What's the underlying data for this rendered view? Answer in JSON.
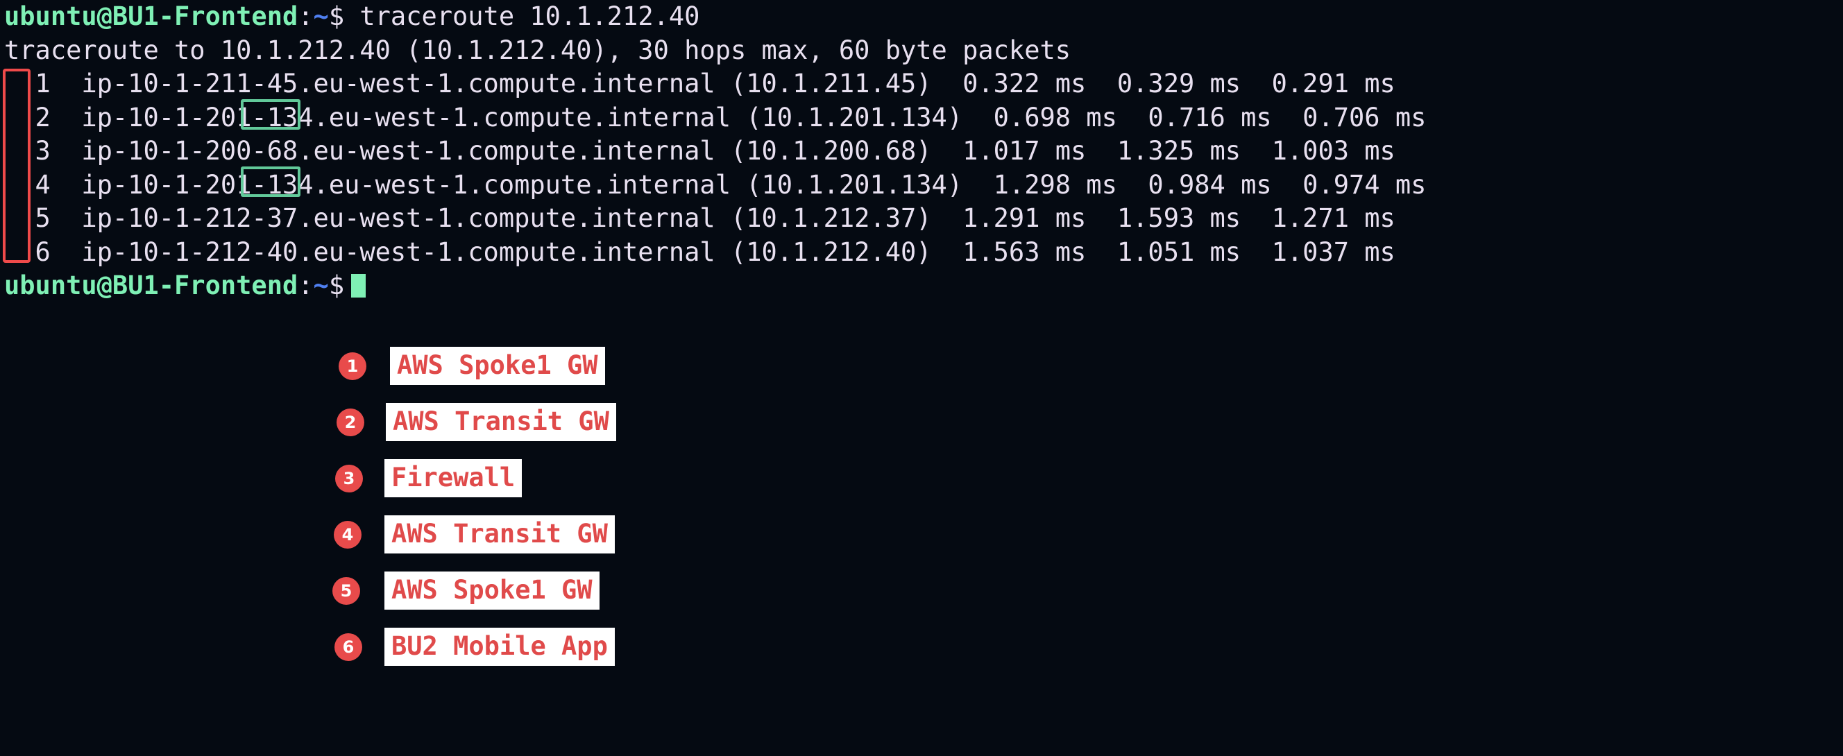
{
  "terminal": {
    "background_color": "#050a12",
    "text_color": "#e8e0f0",
    "prompt_color": "#7ff0b5",
    "prompt": {
      "user_host": "ubuntu@BU1-Frontend",
      "colon": ":",
      "path": "~",
      "dollar": "$"
    },
    "command": " traceroute 10.1.212.40",
    "header_line": "traceroute to 10.1.212.40 (10.1.212.40), 30 hops max, 60 byte packets",
    "hops": [
      {
        "num": "1",
        "hostname": "ip-10-1-211-45.eu-west-1.compute.internal",
        "ip": "(10.1.211.45)",
        "rtt1": "0.322 ms",
        "rtt2": "0.329 ms",
        "rtt3": "0.291 ms",
        "line": "  1  ip-10-1-211-45.eu-west-1.compute.internal (10.1.211.45)  0.322 ms  0.329 ms  0.291 ms"
      },
      {
        "num": "2",
        "hostname": "ip-10-1-201-134.eu-west-1.compute.internal",
        "ip": "(10.1.201.134)",
        "rtt1": "0.698 ms",
        "rtt2": "0.716 ms",
        "rtt3": "0.706 ms",
        "line": "  2  ip-10-1-201-134.eu-west-1.compute.internal (10.1.201.134)  0.698 ms  0.716 ms  0.706 ms"
      },
      {
        "num": "3",
        "hostname": "ip-10-1-200-68.eu-west-1.compute.internal",
        "ip": "(10.1.200.68)",
        "rtt1": "1.017 ms",
        "rtt2": "1.325 ms",
        "rtt3": "1.003 ms",
        "line": "  3  ip-10-1-200-68.eu-west-1.compute.internal (10.1.200.68)  1.017 ms  1.325 ms  1.003 ms"
      },
      {
        "num": "4",
        "hostname": "ip-10-1-201-134.eu-west-1.compute.internal",
        "ip": "(10.1.201.134)",
        "rtt1": "1.298 ms",
        "rtt2": "0.984 ms",
        "rtt3": "0.974 ms",
        "line": "  4  ip-10-1-201-134.eu-west-1.compute.internal (10.1.201.134)  1.298 ms  0.984 ms  0.974 ms"
      },
      {
        "num": "5",
        "hostname": "ip-10-1-212-37.eu-west-1.compute.internal",
        "ip": "(10.1.212.37)",
        "rtt1": "1.291 ms",
        "rtt2": "1.593 ms",
        "rtt3": "1.271 ms",
        "line": "  5  ip-10-1-212-37.eu-west-1.compute.internal (10.1.212.37)  1.291 ms  1.593 ms  1.271 ms"
      },
      {
        "num": "6",
        "hostname": "ip-10-1-212-40.eu-west-1.compute.internal",
        "ip": "(10.1.212.40)",
        "rtt1": "1.563 ms",
        "rtt2": "1.051 ms",
        "rtt3": "1.037 ms",
        "line": "  6  ip-10-1-212-40.eu-west-1.compute.internal (10.1.212.40)  1.563 ms  1.051 ms  1.037 ms"
      }
    ]
  },
  "annotations": {
    "hop_column_marker_color": "#ef4a4a",
    "octet_marker_color": "#62c99a",
    "octet_marker_text": "134",
    "badge_color": "#e84b4b",
    "label_background": "#ffffff",
    "label_text_color": "#e04a4a",
    "legend": [
      {
        "num": "1",
        "label": "AWS Spoke1 GW"
      },
      {
        "num": "2",
        "label": "AWS Transit GW"
      },
      {
        "num": "3",
        "label": "Firewall"
      },
      {
        "num": "4",
        "label": "AWS Transit GW"
      },
      {
        "num": "5",
        "label": "AWS Spoke1 GW"
      },
      {
        "num": "6",
        "label": "BU2 Mobile App"
      }
    ]
  }
}
